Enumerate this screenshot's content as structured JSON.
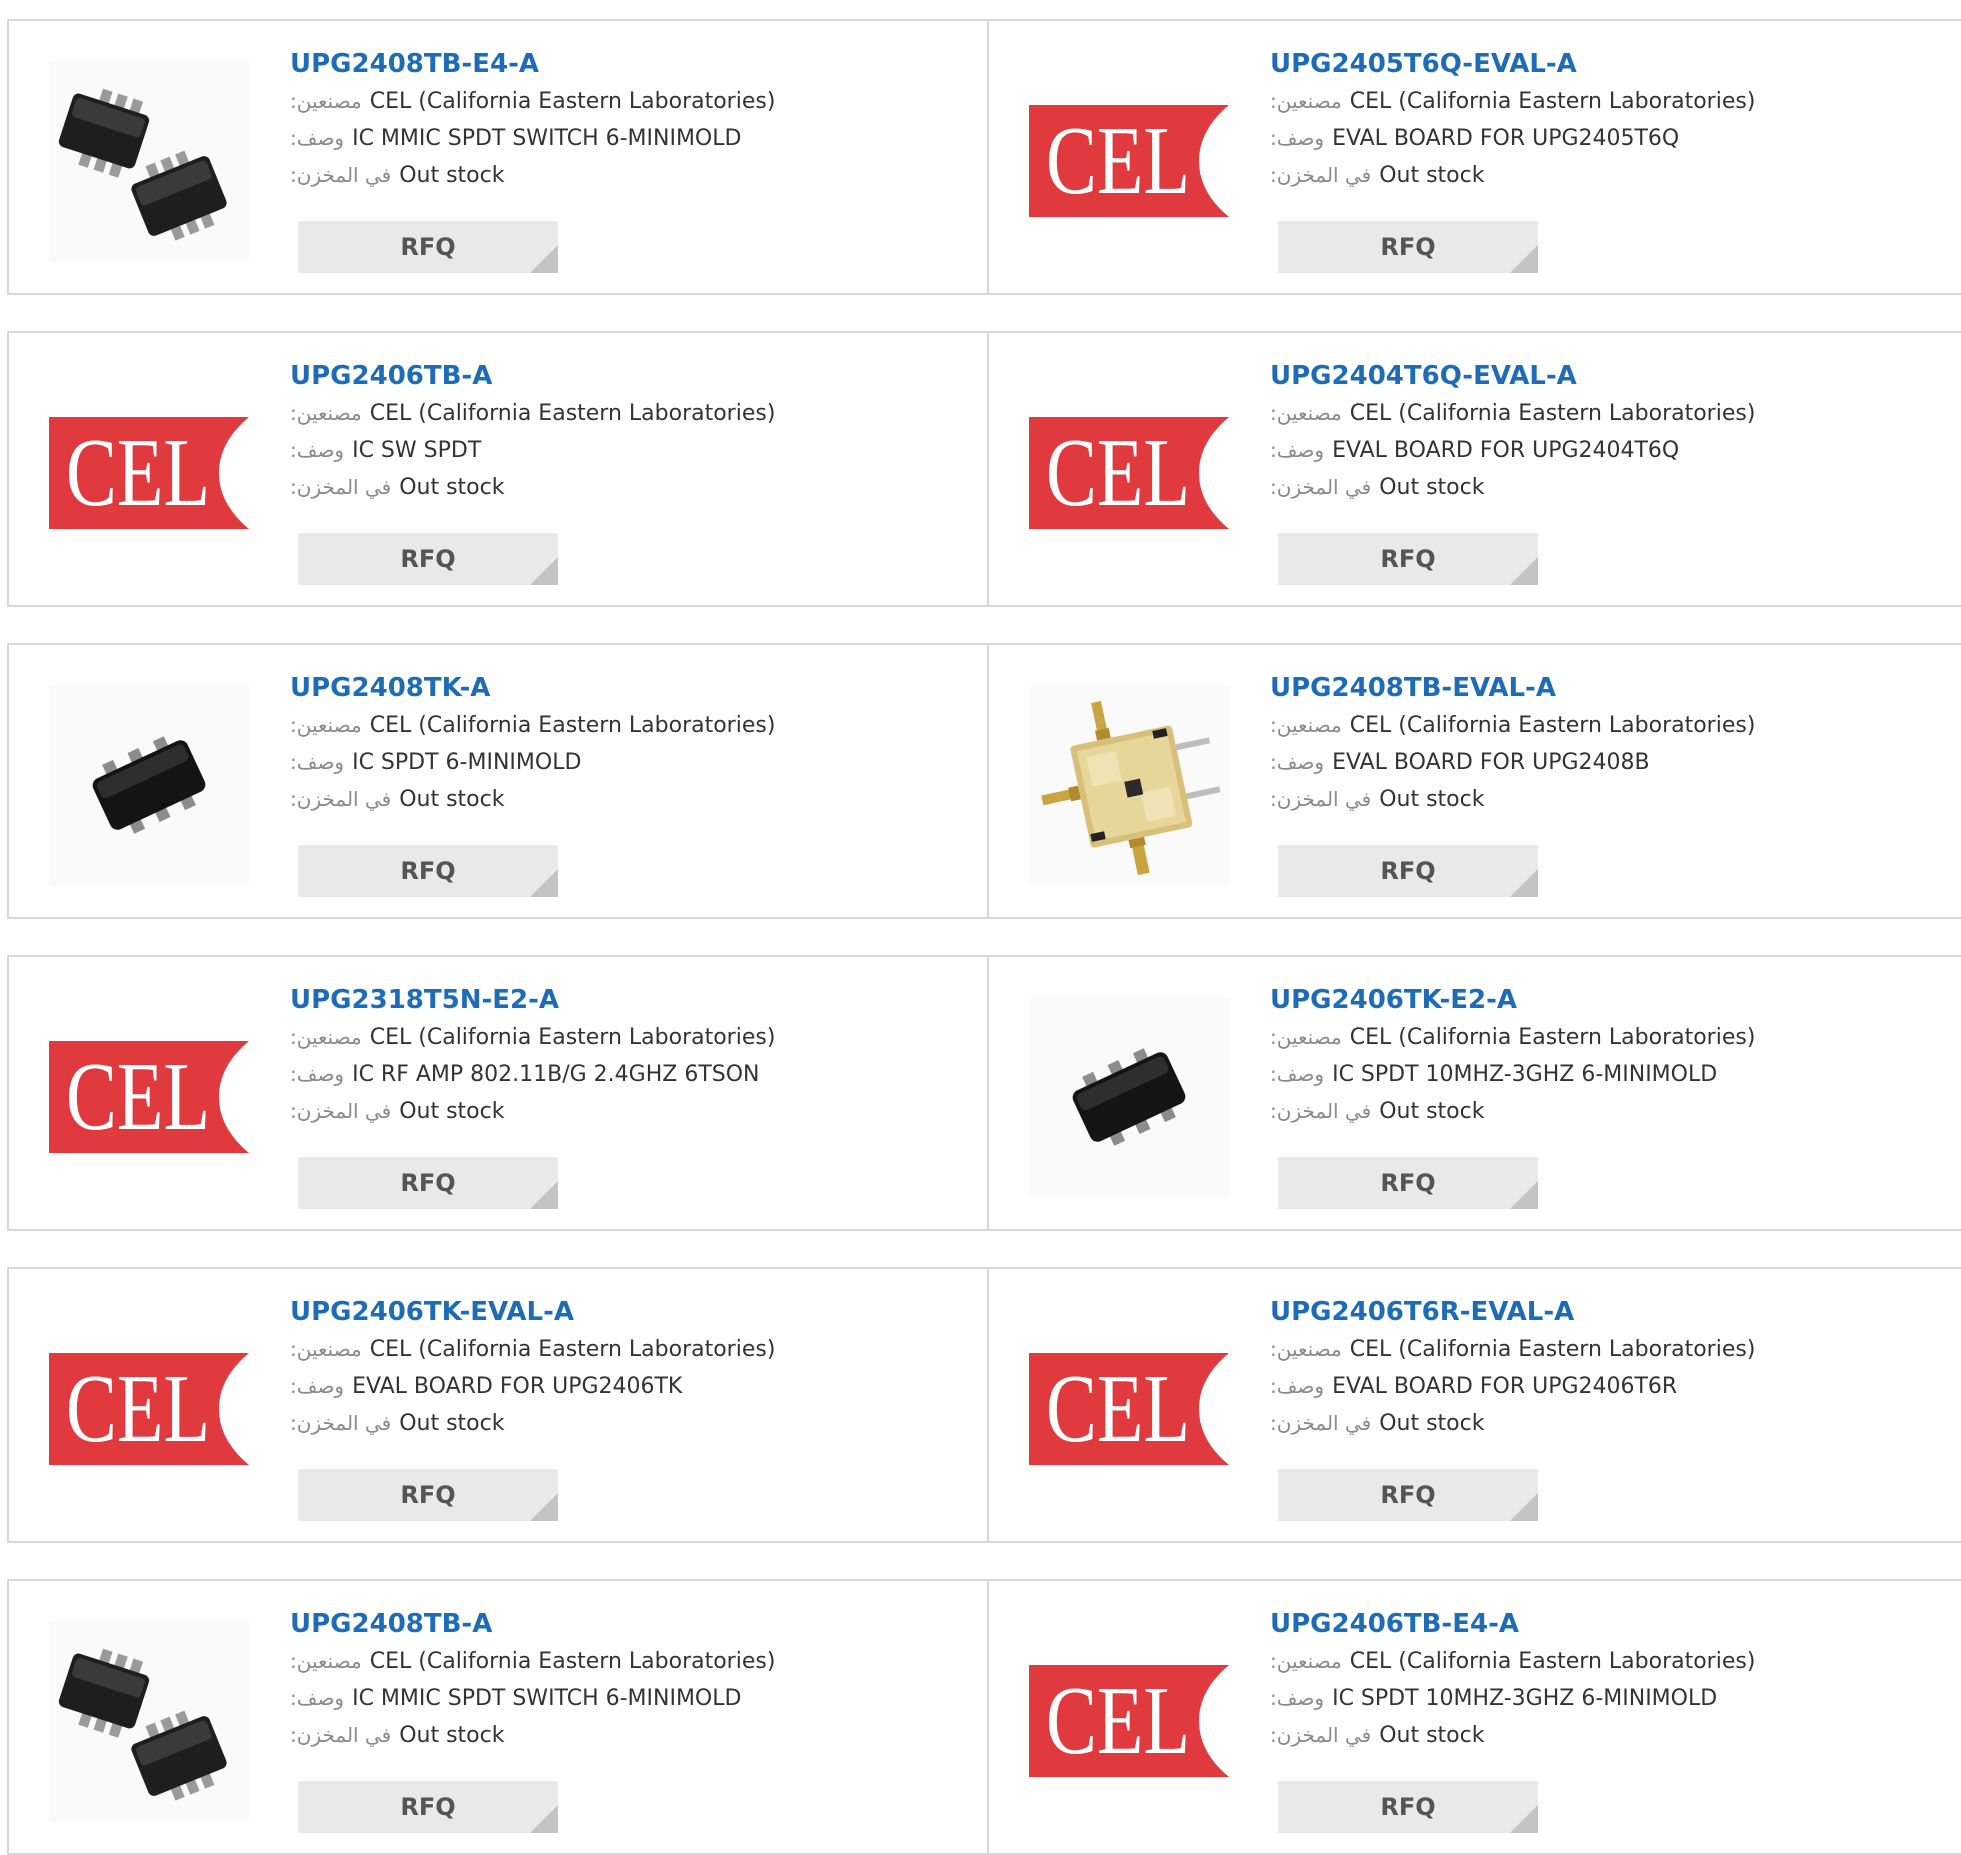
{
  "labels": {
    "manufacturer": ":مصنعين",
    "description": ":وصف",
    "stock": ":في المخزن",
    "rfq": "RFQ"
  },
  "brand_colors": {
    "link": "#1e6bb8",
    "cel_red": "#e03a3e",
    "button_bg": "#e9e9e9"
  },
  "products": [
    {
      "part": "UPG2408TB-E4-A",
      "manufacturer": "CEL (California Eastern Laboratories)",
      "description": "IC MMIC SPDT SWITCH 6-MINIMOLD",
      "stock": "Out stock",
      "image": "chip-pair"
    },
    {
      "part": "UPG2405T6Q-EVAL-A",
      "manufacturer": "CEL (California Eastern Laboratories)",
      "description": "EVAL BOARD FOR UPG2405T6Q",
      "stock": "Out stock",
      "image": "cel-logo",
      "logo_text": "CEL"
    },
    {
      "part": "UPG2406TB-A",
      "manufacturer": "CEL (California Eastern Laboratories)",
      "description": "IC SW SPDT",
      "stock": "Out stock",
      "image": "cel-logo",
      "logo_text": "CEL"
    },
    {
      "part": "UPG2404T6Q-EVAL-A",
      "manufacturer": "CEL (California Eastern Laboratories)",
      "description": "EVAL BOARD FOR UPG2404T6Q",
      "stock": "Out stock",
      "image": "cel-logo",
      "logo_text": "CEL"
    },
    {
      "part": "UPG2408TK-A",
      "manufacturer": "CEL (California Eastern Laboratories)",
      "description": "IC SPDT 6-MINIMOLD",
      "stock": "Out stock",
      "image": "chip-single"
    },
    {
      "part": "UPG2408TB-EVAL-A",
      "manufacturer": "CEL (California Eastern Laboratories)",
      "description": "EVAL BOARD FOR UPG2408B",
      "stock": "Out stock",
      "image": "eval-board"
    },
    {
      "part": "UPG2318T5N-E2-A",
      "manufacturer": "CEL (California Eastern Laboratories)",
      "description": "IC RF AMP 802.11B/G 2.4GHZ 6TSON",
      "stock": "Out stock",
      "image": "cel-logo",
      "logo_text": "CEL"
    },
    {
      "part": "UPG2406TK-E2-A",
      "manufacturer": "CEL (California Eastern Laboratories)",
      "description": "IC SPDT 10MHZ-3GHZ 6-MINIMOLD",
      "stock": "Out stock",
      "image": "chip-single"
    },
    {
      "part": "UPG2406TK-EVAL-A",
      "manufacturer": "CEL (California Eastern Laboratories)",
      "description": "EVAL BOARD FOR UPG2406TK",
      "stock": "Out stock",
      "image": "cel-logo",
      "logo_text": "CEL"
    },
    {
      "part": "UPG2406T6R-EVAL-A",
      "manufacturer": "CEL (California Eastern Laboratories)",
      "description": "EVAL BOARD FOR UPG2406T6R",
      "stock": "Out stock",
      "image": "cel-logo",
      "logo_text": "CEL"
    },
    {
      "part": "UPG2408TB-A",
      "manufacturer": "CEL (California Eastern Laboratories)",
      "description": "IC MMIC SPDT SWITCH 6-MINIMOLD",
      "stock": "Out stock",
      "image": "chip-pair"
    },
    {
      "part": "UPG2406TB-E4-A",
      "manufacturer": "CEL (California Eastern Laboratories)",
      "description": "IC SPDT 10MHZ-3GHZ 6-MINIMOLD",
      "stock": "Out stock",
      "image": "cel-logo",
      "logo_text": "CEL"
    }
  ]
}
